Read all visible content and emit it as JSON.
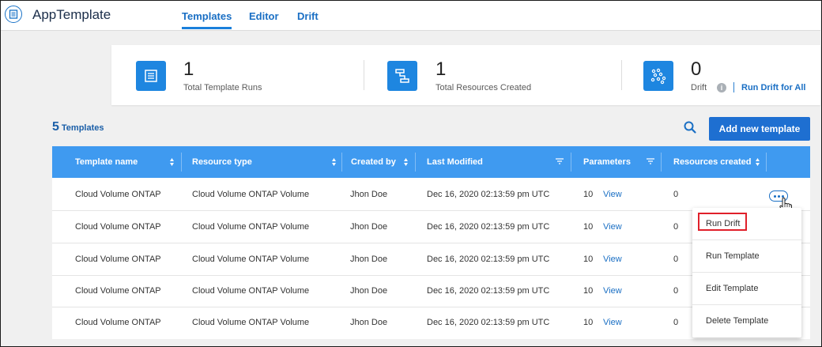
{
  "app": {
    "title": "AppTemplate"
  },
  "nav": {
    "tabs": [
      {
        "label": "Templates",
        "active": true
      },
      {
        "label": "Editor"
      },
      {
        "label": "Drift"
      }
    ]
  },
  "stats": {
    "runs": {
      "value": "1",
      "label": "Total Template Runs"
    },
    "resources": {
      "value": "1",
      "label": "Total Resources Created"
    },
    "drift": {
      "value": "0",
      "label": "Drift",
      "action": "Run Drift for All"
    }
  },
  "toolbar": {
    "count": "5",
    "count_label": "Templates",
    "add_label": "Add new template"
  },
  "table": {
    "headers": [
      "Template name",
      "Resource type",
      "Created by",
      "Last Modified",
      "Parameters",
      "Resources created"
    ],
    "rows": [
      {
        "name": "Cloud Volume ONTAP",
        "type": "Cloud Volume ONTAP  Volume",
        "created_by": "Jhon Doe",
        "modified": "Dec 16, 2020 02:13:59 pm UTC",
        "params": "10",
        "view": "View",
        "resources": "0"
      },
      {
        "name": "Cloud Volume ONTAP",
        "type": "Cloud Volume ONTAP  Volume",
        "created_by": "Jhon Doe",
        "modified": "Dec 16, 2020 02:13:59 pm UTC",
        "params": "10",
        "view": "View",
        "resources": "0"
      },
      {
        "name": "Cloud Volume ONTAP",
        "type": "Cloud Volume ONTAP  Volume",
        "created_by": "Jhon Doe",
        "modified": "Dec 16, 2020 02:13:59 pm UTC",
        "params": "10",
        "view": "View",
        "resources": "0"
      },
      {
        "name": "Cloud Volume ONTAP",
        "type": "Cloud Volume ONTAP  Volume",
        "created_by": "Jhon Doe",
        "modified": "Dec 16, 2020 02:13:59 pm UTC",
        "params": "10",
        "view": "View",
        "resources": "0"
      },
      {
        "name": "Cloud Volume ONTAP",
        "type": "Cloud Volume ONTAP  Volume",
        "created_by": "Jhon Doe",
        "modified": "Dec 16, 2020 02:13:59 pm UTC",
        "params": "10",
        "view": "View",
        "resources": "0"
      }
    ]
  },
  "menu": {
    "items": [
      "Run Drift",
      "Run Template",
      "Edit Template",
      "Delete Template"
    ]
  },
  "colors": {
    "accent": "#1e6fd1",
    "header": "#3f9af0",
    "highlight": "#e0202a"
  },
  "icons": [
    "app-template-icon",
    "document-icon",
    "flow-icon",
    "drift-icon",
    "info-icon",
    "search-icon",
    "sort-icon",
    "filter-icon",
    "more-icon",
    "hand-cursor-icon"
  ]
}
